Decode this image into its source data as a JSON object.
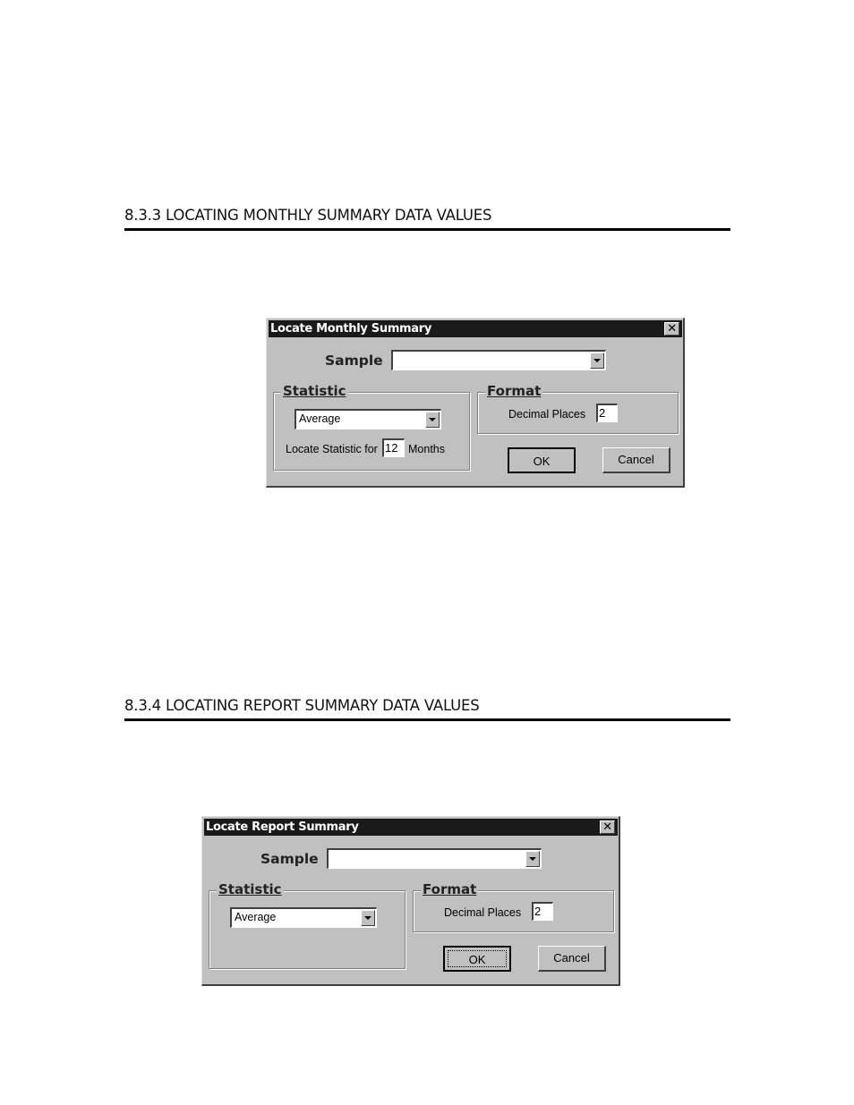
{
  "sections": [
    {
      "heading": "8.3.3  LOCATING MONTHLY SUMMARY DATA VALUES",
      "dialog": {
        "title": "Locate Monthly Summary",
        "close_icon": "close-icon",
        "sample_label": "Sample",
        "sample_value": "",
        "statistic_group_label": "Statistic",
        "statistic_value": "Average",
        "locate_prefix": "Locate Statistic for",
        "months_value": "12",
        "locate_suffix": "Months",
        "format_group_label": "Format",
        "decimal_places_label": "Decimal Places",
        "decimal_places_value": "2",
        "ok_label": "OK",
        "cancel_label": "Cancel"
      }
    },
    {
      "heading": "8.3.4  LOCATING REPORT SUMMARY DATA VALUES",
      "dialog": {
        "title": "Locate Report Summary",
        "close_icon": "close-icon",
        "sample_label": "Sample",
        "sample_value": "",
        "statistic_group_label": "Statistic",
        "statistic_value": "Average",
        "format_group_label": "Format",
        "decimal_places_label": "Decimal Places",
        "decimal_places_value": "2",
        "ok_label": "OK",
        "cancel_label": "Cancel"
      }
    }
  ]
}
